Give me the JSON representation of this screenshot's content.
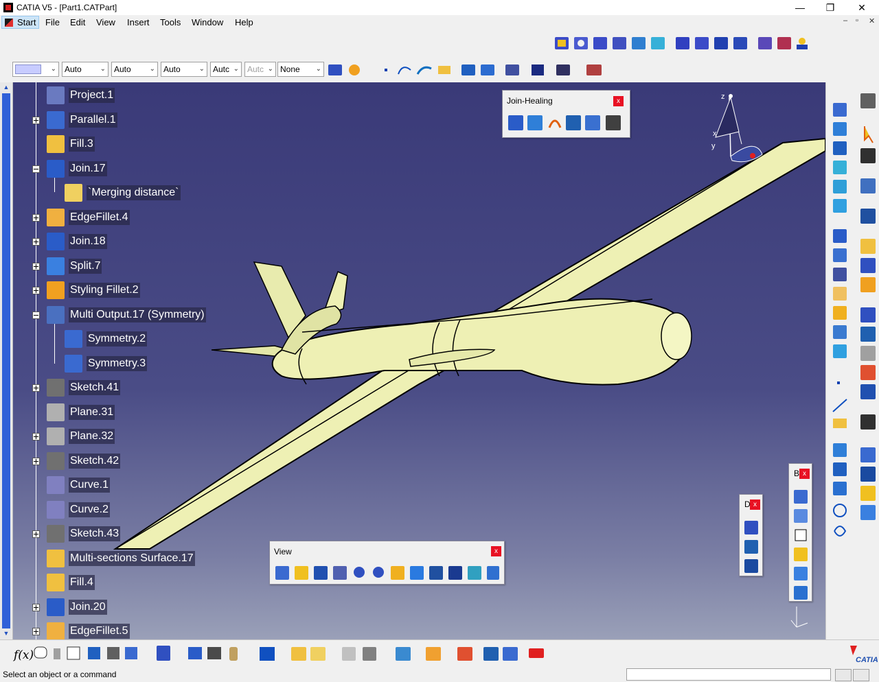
{
  "window": {
    "title": "CATIA V5 - [Part1.CATPart]",
    "minimize": "—",
    "maximize": "❐",
    "close": "✕"
  },
  "menubar": {
    "items": [
      "Start",
      "File",
      "Edit",
      "View",
      "Insert",
      "Tools",
      "Window",
      "Help"
    ]
  },
  "mdi_controls": [
    "–",
    "▫",
    "✕"
  ],
  "toolbar": {
    "color_combo": "",
    "combos": [
      "Auto",
      "Auto",
      "Auto",
      "Autc",
      "Autc"
    ],
    "layer_combo": "None"
  },
  "tree": {
    "nodes": [
      {
        "label": "Project.1",
        "icon": "project-icon",
        "expander": "none",
        "indent": 0
      },
      {
        "label": "Parallel.1",
        "icon": "parallel-icon",
        "expander": "plus",
        "indent": 0
      },
      {
        "label": "Fill.3",
        "icon": "fill-icon",
        "expander": "none",
        "indent": 0
      },
      {
        "label": "Join.17",
        "icon": "join-icon",
        "expander": "minus",
        "indent": 0
      },
      {
        "label": "`Merging distance`",
        "icon": "parameter-icon",
        "expander": "none",
        "indent": 1
      },
      {
        "label": "EdgeFillet.4",
        "icon": "edgefillet-icon",
        "expander": "plus",
        "indent": 0
      },
      {
        "label": "Join.18",
        "icon": "join-icon",
        "expander": "plus",
        "indent": 0
      },
      {
        "label": "Split.7",
        "icon": "split-icon",
        "expander": "plus",
        "indent": 0
      },
      {
        "label": "Styling Fillet.2",
        "icon": "styling-fillet-icon",
        "expander": "plus",
        "indent": 0
      },
      {
        "label": "Multi Output.17 (Symmetry)",
        "icon": "multi-output-icon",
        "expander": "minus",
        "indent": 0
      },
      {
        "label": "Symmetry.2",
        "icon": "symmetry-icon",
        "expander": "none",
        "indent": 1
      },
      {
        "label": "Symmetry.3",
        "icon": "symmetry-icon",
        "expander": "none",
        "indent": 1
      },
      {
        "label": "Sketch.41",
        "icon": "sketch-icon",
        "expander": "plus",
        "indent": 0
      },
      {
        "label": "Plane.31",
        "icon": "plane-icon",
        "expander": "none",
        "indent": 0
      },
      {
        "label": "Plane.32",
        "icon": "plane-icon",
        "expander": "plus",
        "indent": 0
      },
      {
        "label": "Sketch.42",
        "icon": "sketch-icon",
        "expander": "plus",
        "indent": 0
      },
      {
        "label": "Curve.1",
        "icon": "curve-icon",
        "expander": "none",
        "indent": 0
      },
      {
        "label": "Curve.2",
        "icon": "curve-icon",
        "expander": "none",
        "indent": 0
      },
      {
        "label": "Sketch.43",
        "icon": "sketch-icon",
        "expander": "plus",
        "indent": 0
      },
      {
        "label": "Multi-sections Surface.17",
        "icon": "multi-sections-surface-icon",
        "expander": "none",
        "indent": 0
      },
      {
        "label": "Fill.4",
        "icon": "fill-icon",
        "expander": "none",
        "indent": 0
      },
      {
        "label": "Join.20",
        "icon": "join-icon",
        "expander": "plus",
        "indent": 0
      },
      {
        "label": "EdgeFillet.5",
        "icon": "edgefillet-icon",
        "expander": "plus",
        "indent": 0
      }
    ]
  },
  "compass": {
    "z": "z",
    "x": "x",
    "y": "y"
  },
  "join_healing_panel": {
    "title": "Join-Healing",
    "close": "x"
  },
  "view_panel": {
    "title": "View",
    "close": "x"
  },
  "small_panel_d": {
    "title": "D",
    "close": "x"
  },
  "small_panel_b": {
    "title": "B",
    "close": "x"
  },
  "status": {
    "text": "Select an object or a command"
  },
  "colors": {
    "viewport_top": "#3a3a78",
    "viewport_bottom": "#9aa0b8",
    "model": "#eef0b4",
    "tree_label_bg": "#28284a"
  }
}
